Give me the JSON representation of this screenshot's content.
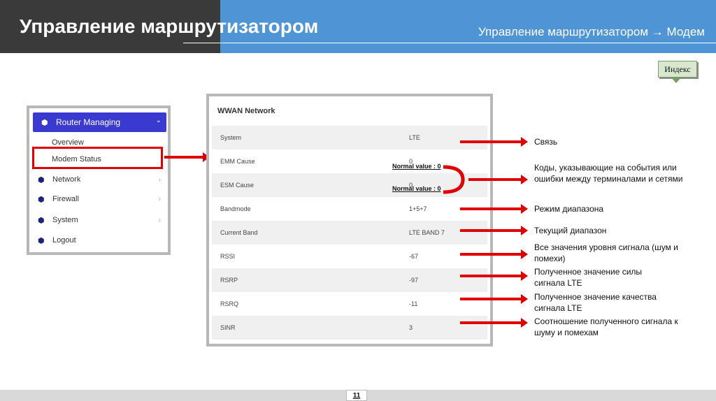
{
  "header": {
    "title": "Управление маршрутизатором",
    "breadcrumb": "Управление маршрутизатором → Модем"
  },
  "index_button": {
    "label": "Индекс"
  },
  "sidebar": {
    "head": "Router Managing",
    "sub_items": [
      "Overview",
      "Modem Status"
    ],
    "items": [
      "Network",
      "Firewall",
      "System",
      "Logout"
    ]
  },
  "wwan": {
    "title": "WWAN Network",
    "rows": [
      {
        "key": "System",
        "value": "LTE"
      },
      {
        "key": "EMM Cause",
        "value": "0"
      },
      {
        "key": "ESM Cause",
        "value": "0"
      },
      {
        "key": "Bandmode",
        "value": "1+5+7"
      },
      {
        "key": "Current Band",
        "value": "LTE BAND 7"
      },
      {
        "key": "RSSI",
        "value": "-67"
      },
      {
        "key": "RSRP",
        "value": "-97"
      },
      {
        "key": "RSRQ",
        "value": "-11"
      },
      {
        "key": "SINR",
        "value": "3"
      }
    ],
    "normal_value_label": "Normal value : 0"
  },
  "annotations": [
    "Связь",
    "Коды, указывающие на события или ошибки между терминалами и сетями",
    "Режим диапазона",
    "Текущий диапазон",
    "Все значения уровня сигнала (шум и помехи)",
    "Полученное значение силы сигнала LTE",
    "Полученное значение качества сигнала LTE",
    "Соотношение полученного сигнала к шуму и помехам"
  ],
  "footer": {
    "page": "11"
  },
  "colors": {
    "accent_red": "#e00000",
    "header_blue": "#4f95d6",
    "header_dark": "#3a3a3a",
    "menu_blue": "#3a3ad0"
  }
}
